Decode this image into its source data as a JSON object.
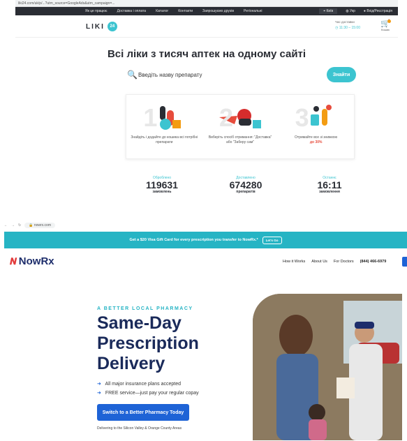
{
  "liki": {
    "url_text": "liki24.com/uk/p/...?utm_source=GoogleAds&utm_campaign=...",
    "nav_items": [
      "Як це працює",
      "Доставка і оплата",
      "Каталог",
      "Контакти",
      "Запрошуємо друзів",
      "Регіональні"
    ],
    "city": "Київ",
    "lang": "Укр",
    "account": "Вхід/Реєстрація",
    "logo_text": "LIKI",
    "logo_badge": "24",
    "delivery_label": "Час доставки",
    "delivery_time": "11:30 – 15:00",
    "cart_label": "Кошик",
    "headline": "Всі ліки з тисяч аптек на одному сайті",
    "search_placeholder": "Введіть назву препарату",
    "search_button": "Знайти",
    "steps": [
      {
        "num": "1",
        "text": "Знайдіть і додайте до кошика всі потрібні препарати",
        "accent": ""
      },
      {
        "num": "2",
        "text": "Виберіть спосіб отримання: \"Доставка\" або \"Заберу сам\"",
        "accent": ""
      },
      {
        "num": "3",
        "text": "Отримайте все зі знижкою",
        "accent": "до 30%"
      }
    ],
    "stats": [
      {
        "label": "Оброблено",
        "value": "119631",
        "sub": "замовлень"
      },
      {
        "label": "Доставлено",
        "value": "674280",
        "sub": "препаратів"
      },
      {
        "label": "Останнє",
        "value": "16:11",
        "sub": "замовлення"
      }
    ]
  },
  "nowrx": {
    "address": "nowrx.com",
    "promo_text": "Get a $20 Visa Gift Card for every prescription you transfer to NowRx.*",
    "promo_button": "Let's Go",
    "logo_text": "NowRx",
    "nav": [
      "How it Works",
      "About Us",
      "For Doctors"
    ],
    "phone": "(844) 466-6979",
    "eyebrow": "A BETTER LOCAL PHARMACY",
    "headline_lines": [
      "Same-Day",
      "Prescription",
      "Delivery"
    ],
    "bullets": [
      "All major insurance plans accepted",
      "FREE service—just pay your regular copay"
    ],
    "cta": "Switch to a Better Pharmacy Today",
    "area_note": "Delivering to the Silicon Valley & Orange County Areas"
  },
  "colors": {
    "liki_accent": "#3cc4d0",
    "nowrx_teal": "#26b4c4",
    "nowrx_blue": "#1e63d6",
    "nowrx_navy": "#1a2a5a"
  }
}
